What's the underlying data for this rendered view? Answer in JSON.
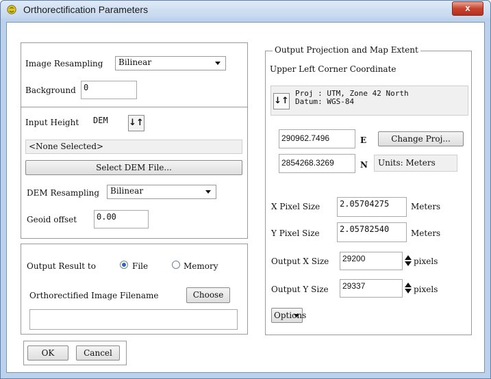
{
  "window": {
    "title": "Orthorectification Parameters",
    "close_glyph": "x",
    "app_icon": "envi-icon"
  },
  "resampling": {
    "image_resampling_label": "Image Resampling",
    "image_resampling_value": "Bilinear",
    "background_label": "Background",
    "background_value": "0"
  },
  "height": {
    "input_height_label": "Input Height",
    "input_height_value": "DEM",
    "swap_glyph": "↓↑",
    "dem_selected_text": "<None Selected>",
    "select_dem_button": "Select DEM File...",
    "dem_resampling_label": "DEM Resampling",
    "dem_resampling_value": "Bilinear",
    "geoid_offset_label": "Geoid offset",
    "geoid_offset_value": "0.00"
  },
  "output": {
    "output_result_label": "Output Result to",
    "file_option": "File",
    "memory_option": "Memory",
    "selected": "File",
    "filename_label": "Orthorectified Image Filename",
    "choose_button": "Choose",
    "filename_value": ""
  },
  "buttons": {
    "ok": "OK",
    "cancel": "Cancel"
  },
  "projection": {
    "legend": "Output Projection and Map Extent",
    "upper_left_label": "Upper Left Corner Coordinate",
    "swap_glyph": "↓↑",
    "proj_line": "Proj : UTM, Zone 42 North",
    "datum_line": "Datum: WGS-84",
    "easting_value": "290962.7496",
    "easting_unit": "E",
    "northing_value": "2854268.3269",
    "northing_unit": "N",
    "change_proj_button": "Change Proj...",
    "units_text": "Units: Meters",
    "x_pixel_label": "X Pixel Size",
    "x_pixel_value": "2.05704275",
    "x_pixel_unit": "Meters",
    "y_pixel_label": "Y Pixel Size",
    "y_pixel_value": "2.05782540",
    "y_pixel_unit": "Meters",
    "output_x_label": "Output X Size",
    "output_x_value": "29200",
    "output_x_unit": "pixels",
    "output_y_label": "Output Y Size",
    "output_y_value": "29337",
    "output_y_unit": "pixels",
    "options_button": "Options"
  },
  "colors": {
    "title_bar": "#c3d6ee",
    "close_button": "#c8432f",
    "radio_selected": "#2d66c4"
  }
}
